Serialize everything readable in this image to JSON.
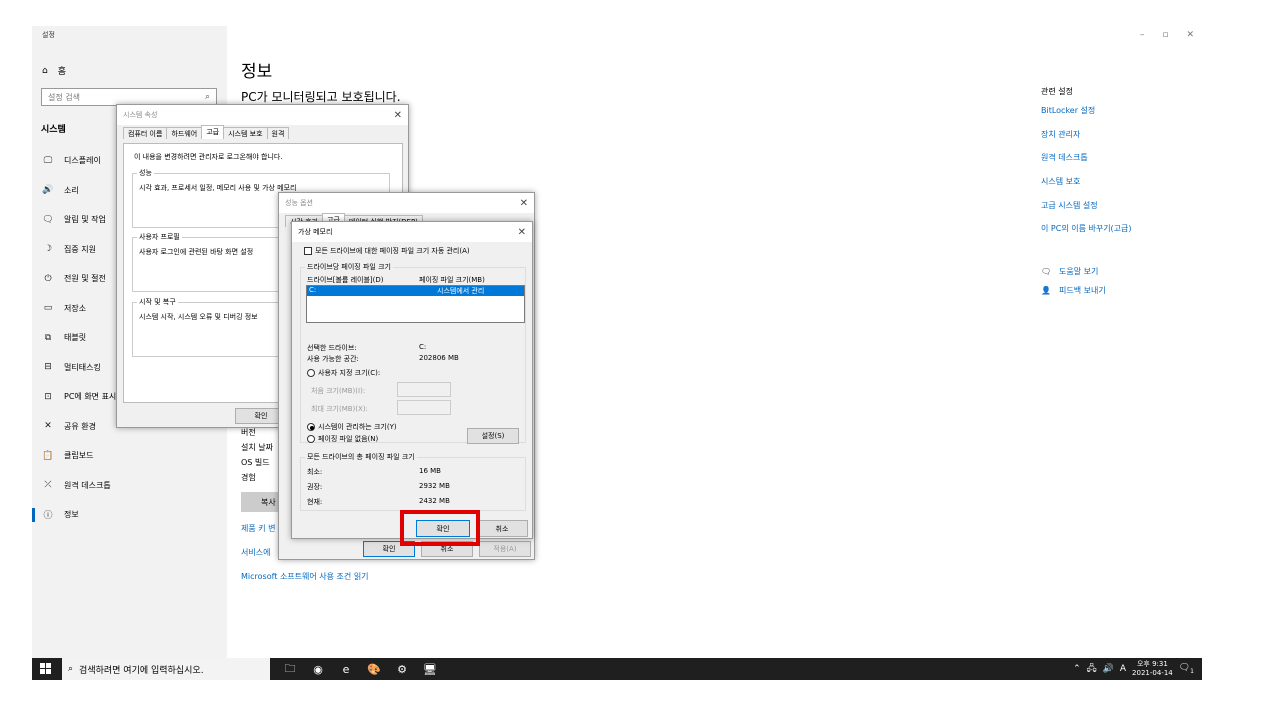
{
  "app": {
    "title": "설정",
    "window_controls": {
      "minimize": "–",
      "maximize": "▫",
      "close": "✕"
    }
  },
  "sidebar": {
    "home_label": "홈",
    "search_placeholder": "설정 검색",
    "section": "시스템",
    "items": [
      {
        "label": "디스플레이",
        "icon": "monitor-icon",
        "glyph": "🖵"
      },
      {
        "label": "소리",
        "icon": "speaker-icon",
        "glyph": "🔊"
      },
      {
        "label": "알림 및 작업",
        "icon": "notification-icon",
        "glyph": "🗨"
      },
      {
        "label": "집중 지원",
        "icon": "moon-icon",
        "glyph": "☽"
      },
      {
        "label": "전원 및 절전",
        "icon": "power-icon",
        "glyph": "⏻"
      },
      {
        "label": "저장소",
        "icon": "storage-icon",
        "glyph": "▭"
      },
      {
        "label": "태블릿",
        "icon": "tablet-icon",
        "glyph": "⧉"
      },
      {
        "label": "멀티태스킹",
        "icon": "multitask-icon",
        "glyph": "⊟"
      },
      {
        "label": "PC에 화면 표시",
        "icon": "project-icon",
        "glyph": "⊡"
      },
      {
        "label": "공유 환경",
        "icon": "share-icon",
        "glyph": "✕"
      },
      {
        "label": "클립보드",
        "icon": "clipboard-icon",
        "glyph": "📋"
      },
      {
        "label": "원격 데스크톱",
        "icon": "remote-icon",
        "glyph": "⤫"
      },
      {
        "label": "정보",
        "icon": "info-icon",
        "glyph": "ⓘ"
      }
    ]
  },
  "main": {
    "title": "정보",
    "subtitle": "PC가 모니터링되고 보호됩니다.",
    "labels": {
      "version": "버전",
      "install_date": "설치 날짜",
      "os_build": "OS 빌드",
      "experience": "경험"
    },
    "copy_button": "복사",
    "product_key_link": "제품 키 변",
    "services_link": "서비스에",
    "license_link": "Microsoft 소프트웨어 사용 조건 읽기"
  },
  "related": {
    "title": "관련 설정",
    "links": [
      "BitLocker 설정",
      "장치 관리자",
      "원격 데스크톱",
      "시스템 보호",
      "고급 시스템 설정",
      "이 PC의 이름 바꾸기(고급)"
    ],
    "help": "도움말 보기",
    "feedback": "피드백 보내기"
  },
  "sysprops": {
    "title": "시스템 속성",
    "tabs": [
      "컴퓨터 이름",
      "하드웨어",
      "고급",
      "시스템 보호",
      "원격"
    ],
    "admin_note": "이 내용을 변경하려면 관리자로 로그온해야 합니다.",
    "perf_label": "성능",
    "perf_desc": "시각 효과, 프로세서 일정, 메모리 사용 및 가상 메모리",
    "profile_label": "사용자 프로필",
    "profile_desc": "사용자 로그인에 관련된 바탕 화면 설정",
    "startup_label": "시작 및 복구",
    "startup_desc": "시스템 시작, 시스템 오류 및 디버깅 정보",
    "ok": "확인"
  },
  "perfopts": {
    "title": "성능 옵션",
    "tabs": [
      "시각 효과",
      "고급",
      "데이터 실행 방지(DEP)"
    ],
    "ok": "확인",
    "cancel": "취소",
    "apply": "적용(A)"
  },
  "vmem": {
    "title": "가상 메모리",
    "auto_manage": "모든 드라이브에 대한 페이징 파일 크기 자동 관리(A)",
    "group_label": "드라이브당 페이징 파일 크기",
    "col_drive": "드라이브[볼륨 레이블](D)",
    "col_size": "페이징 파일 크기(MB)",
    "row_drive": "C:",
    "row_size": "시스템에서 관리",
    "selected_drive_label": "선택한 드라이브:",
    "selected_drive_value": "C:",
    "space_label": "사용 가능한 공간:",
    "space_value": "202806 MB",
    "custom_size": "사용자 지정 크기(C):",
    "initial_size": "처음 크기(MB)(I):",
    "max_size": "최대 크기(MB)(X):",
    "system_managed": "시스템이 관리하는 크기(Y)",
    "no_paging": "페이징 파일 없음(N)",
    "set_button": "설정(S)",
    "total_label": "모든 드라이브의 총 페이징 파일 크기",
    "min_label": "최소:",
    "min_value": "16 MB",
    "rec_label": "권장:",
    "rec_value": "2932 MB",
    "cur_label": "현재:",
    "cur_value": "2432 MB",
    "ok": "확인",
    "cancel": "취소"
  },
  "taskbar": {
    "search_placeholder": "검색하려면 여기에 입력하십시오.",
    "apps": [
      {
        "name": "file-explorer-icon",
        "glyph": "🗀"
      },
      {
        "name": "chrome-icon",
        "glyph": "◉"
      },
      {
        "name": "edge-icon",
        "glyph": "e"
      },
      {
        "name": "paint-icon",
        "glyph": "🎨"
      },
      {
        "name": "settings-icon",
        "glyph": "⚙"
      },
      {
        "name": "system-icon",
        "glyph": "🖥"
      }
    ],
    "ime": "A",
    "time": "오후 9:31",
    "date": "2021-04-14",
    "notifications": "1"
  },
  "colors": {
    "accent": "#0067c0",
    "highlight": "#e00000",
    "taskbar": "#1f1f1f"
  }
}
